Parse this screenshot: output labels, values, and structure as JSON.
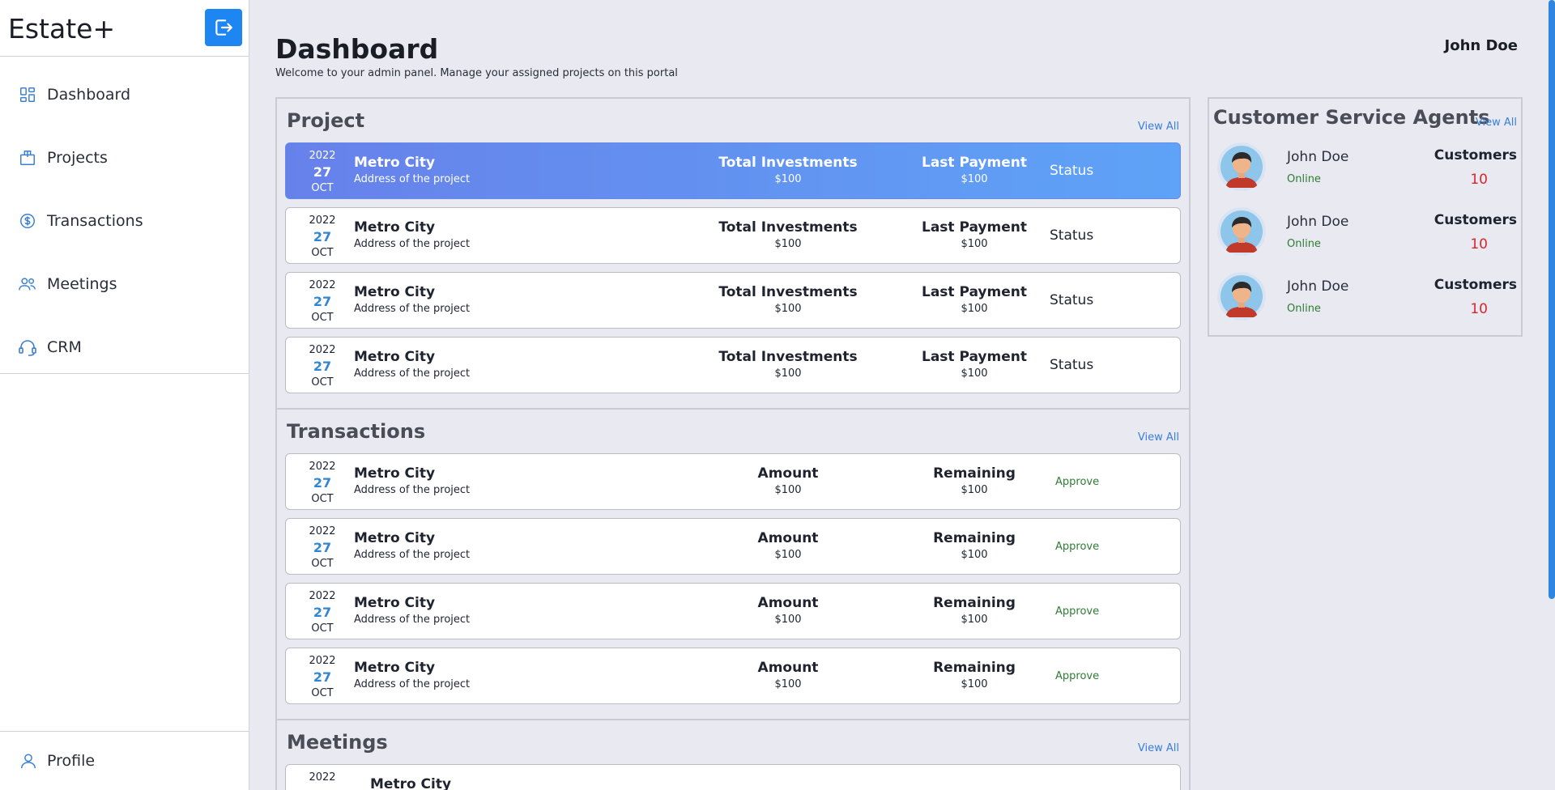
{
  "brand": "Estate+",
  "sidebar": {
    "items": [
      {
        "label": "Dashboard",
        "icon": "dashboard-icon"
      },
      {
        "label": "Projects",
        "icon": "projects-icon"
      },
      {
        "label": "Transactions",
        "icon": "dollar-circle-icon"
      },
      {
        "label": "Meetings",
        "icon": "users-icon"
      },
      {
        "label": "CRM",
        "icon": "headset-icon"
      }
    ],
    "profile_label": "Profile"
  },
  "header": {
    "title": "Dashboard",
    "subtitle": "Welcome to your admin panel. Manage your assigned projects on this portal",
    "user": "John Doe"
  },
  "projects": {
    "title": "Project",
    "view_all": "View All",
    "rows": [
      {
        "year": "2022",
        "day": "27",
        "month": "OCT",
        "name": "Metro City",
        "address": "Address of the project",
        "h1": "Total Investments",
        "v1": "$100",
        "h2": "Last Payment",
        "v2": "$100",
        "status": "Status"
      },
      {
        "year": "2022",
        "day": "27",
        "month": "OCT",
        "name": "Metro City",
        "address": "Address of the project",
        "h1": "Total Investments",
        "v1": "$100",
        "h2": "Last Payment",
        "v2": "$100",
        "status": "Status"
      },
      {
        "year": "2022",
        "day": "27",
        "month": "OCT",
        "name": "Metro City",
        "address": "Address of the project",
        "h1": "Total Investments",
        "v1": "$100",
        "h2": "Last Payment",
        "v2": "$100",
        "status": "Status"
      },
      {
        "year": "2022",
        "day": "27",
        "month": "OCT",
        "name": "Metro City",
        "address": "Address of the project",
        "h1": "Total Investments",
        "v1": "$100",
        "h2": "Last Payment",
        "v2": "$100",
        "status": "Status"
      }
    ]
  },
  "transactions": {
    "title": "Transactions",
    "view_all": "View All",
    "rows": [
      {
        "year": "2022",
        "day": "27",
        "month": "OCT",
        "name": "Metro City",
        "address": "Address of the project",
        "h1": "Amount",
        "v1": "$100",
        "h2": "Remaining",
        "v2": "$100",
        "action": "Approve"
      },
      {
        "year": "2022",
        "day": "27",
        "month": "OCT",
        "name": "Metro City",
        "address": "Address of the project",
        "h1": "Amount",
        "v1": "$100",
        "h2": "Remaining",
        "v2": "$100",
        "action": "Approve"
      },
      {
        "year": "2022",
        "day": "27",
        "month": "OCT",
        "name": "Metro City",
        "address": "Address of the project",
        "h1": "Amount",
        "v1": "$100",
        "h2": "Remaining",
        "v2": "$100",
        "action": "Approve"
      },
      {
        "year": "2022",
        "day": "27",
        "month": "OCT",
        "name": "Metro City",
        "address": "Address of the project",
        "h1": "Amount",
        "v1": "$100",
        "h2": "Remaining",
        "v2": "$100",
        "action": "Approve"
      }
    ]
  },
  "meetings": {
    "title": "Meetings",
    "view_all": "View All",
    "rows": [
      {
        "year": "2022",
        "name": "Metro City"
      }
    ]
  },
  "agents": {
    "title": "Customer Service Agents",
    "view_all": "View All",
    "list": [
      {
        "name": "John Doe",
        "status": "Online",
        "label": "Customers",
        "count": "10"
      },
      {
        "name": "John Doe",
        "status": "Online",
        "label": "Customers",
        "count": "10"
      },
      {
        "name": "John Doe",
        "status": "Online",
        "label": "Customers",
        "count": "10"
      }
    ]
  },
  "colors": {
    "accent": "#1e86f2",
    "online": "#2e7d32",
    "count": "#d8262d",
    "approve": "#2e7d32"
  }
}
